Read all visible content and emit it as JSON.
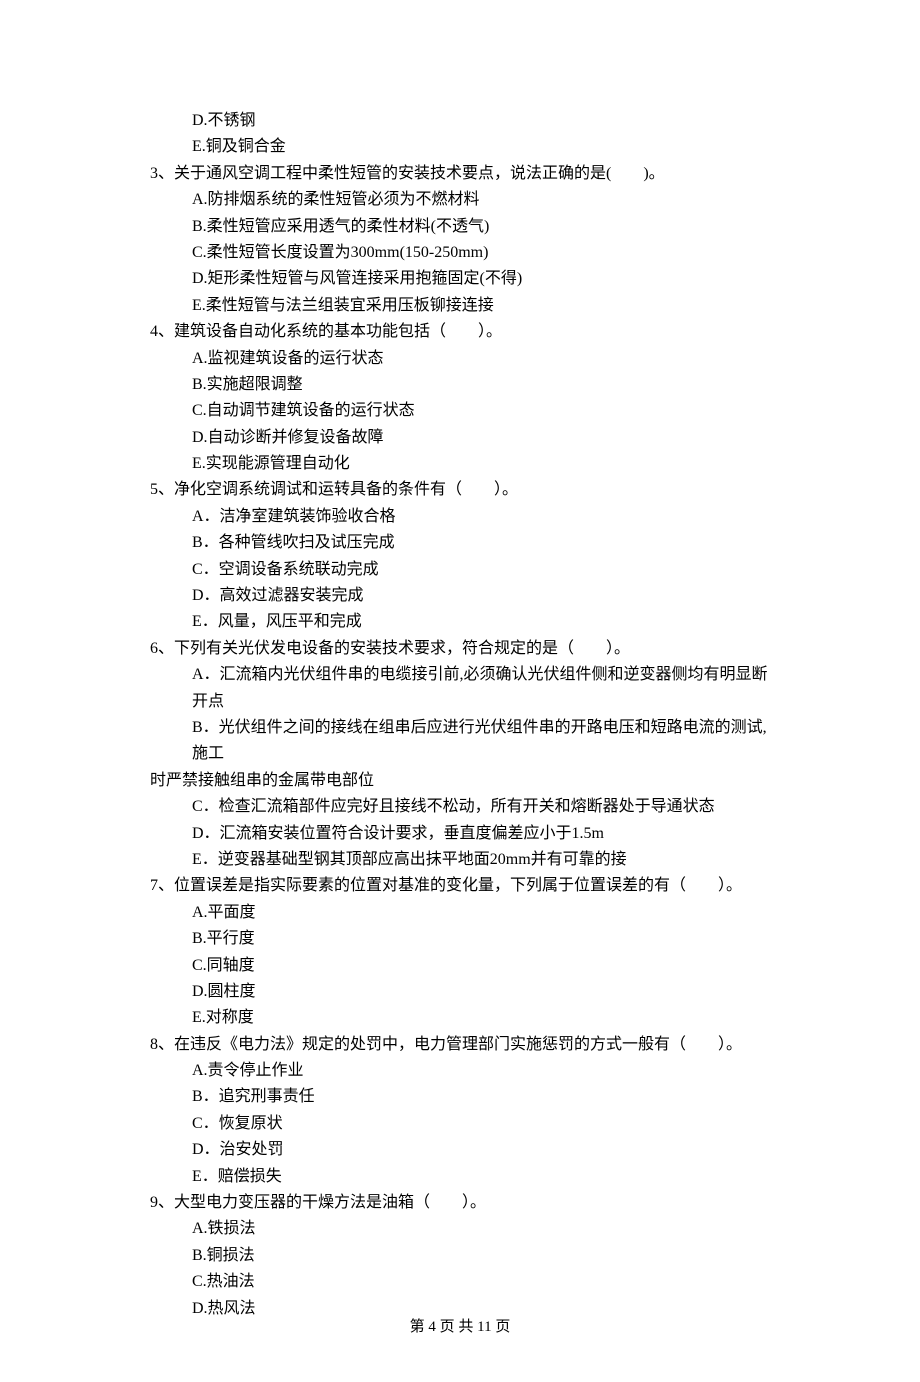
{
  "items": [
    {
      "type": "option",
      "text": "D.不锈钢"
    },
    {
      "type": "option",
      "text": "E.铜及铜合金"
    },
    {
      "type": "question",
      "text": "3、关于通风空调工程中柔性短管的安装技术要点，说法正确的是(　　)。"
    },
    {
      "type": "option",
      "text": "A.防排烟系统的柔性短管必须为不燃材料"
    },
    {
      "type": "option",
      "text": "B.柔性短管应采用透气的柔性材料(不透气)"
    },
    {
      "type": "option",
      "text": "C.柔性短管长度设置为300mm(150-250mm)"
    },
    {
      "type": "option",
      "text": "D.矩形柔性短管与风管连接采用抱箍固定(不得)"
    },
    {
      "type": "option",
      "text": "E.柔性短管与法兰组装宜采用压板铆接连接"
    },
    {
      "type": "question",
      "text": "4、建筑设备自动化系统的基本功能包括（　　）。"
    },
    {
      "type": "option",
      "text": "A.监视建筑设备的运行状态"
    },
    {
      "type": "option",
      "text": "B.实施超限调整"
    },
    {
      "type": "option",
      "text": "C.自动调节建筑设备的运行状态"
    },
    {
      "type": "option",
      "text": "D.自动诊断并修复设备故障"
    },
    {
      "type": "option",
      "text": "E.实现能源管理自动化"
    },
    {
      "type": "question",
      "text": "5、净化空调系统调试和运转具备的条件有（　　）。"
    },
    {
      "type": "option",
      "text": "A．洁净室建筑装饰验收合格"
    },
    {
      "type": "option",
      "text": "B．各种管线吹扫及试压完成"
    },
    {
      "type": "option",
      "text": "C．空调设备系统联动完成"
    },
    {
      "type": "option",
      "text": "D．高效过滤器安装完成"
    },
    {
      "type": "option",
      "text": "E．风量，风压平和完成"
    },
    {
      "type": "question",
      "text": "6、下列有关光伏发电设备的安装技术要求，符合规定的是（　　）。"
    },
    {
      "type": "option",
      "text": "A．汇流箱内光伏组件串的电缆接引前,必须确认光伏组件侧和逆变器侧均有明显断开点"
    },
    {
      "type": "option",
      "text": "B．光伏组件之间的接线在组串后应进行光伏组件串的开路电压和短路电流的测试,施工"
    },
    {
      "type": "question-continued",
      "text": "时严禁接触组串的金属带电部位"
    },
    {
      "type": "option",
      "text": "C．检查汇流箱部件应完好且接线不松动，所有开关和熔断器处于导通状态"
    },
    {
      "type": "option",
      "text": "D．汇流箱安装位置符合设计要求，垂直度偏差应小于1.5m"
    },
    {
      "type": "option",
      "text": "E．逆变器基础型钢其顶部应高出抹平地面20mm并有可靠的接"
    },
    {
      "type": "question",
      "text": "7、位置误差是指实际要素的位置对基准的变化量，下列属于位置误差的有（　　）。"
    },
    {
      "type": "option",
      "text": "A.平面度"
    },
    {
      "type": "option",
      "text": "B.平行度"
    },
    {
      "type": "option",
      "text": "C.同轴度"
    },
    {
      "type": "option",
      "text": "D.圆柱度"
    },
    {
      "type": "option",
      "text": "E.对称度"
    },
    {
      "type": "question",
      "text": "8、在违反《电力法》规定的处罚中，电力管理部门实施惩罚的方式一般有（　　）。"
    },
    {
      "type": "option",
      "text": "A.责令停止作业"
    },
    {
      "type": "option",
      "text": "B．追究刑事责任"
    },
    {
      "type": "option",
      "text": "C．恢复原状"
    },
    {
      "type": "option",
      "text": "D．治安处罚"
    },
    {
      "type": "option",
      "text": "E．赔偿损失"
    },
    {
      "type": "question",
      "text": "9、大型电力变压器的干燥方法是油箱（　　）。"
    },
    {
      "type": "option",
      "text": "A.铁损法"
    },
    {
      "type": "option",
      "text": "B.铜损法"
    },
    {
      "type": "option",
      "text": "C.热油法"
    },
    {
      "type": "option",
      "text": "D.热风法"
    }
  ],
  "footer": "第 4 页 共 11 页"
}
